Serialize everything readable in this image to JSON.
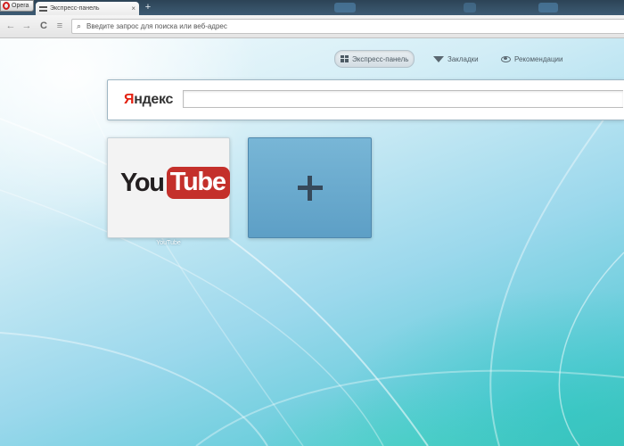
{
  "browser": {
    "menu_label": "Opera",
    "active_tab": {
      "title": "Экспресс-панель",
      "close_glyph": "×"
    },
    "new_tab_glyph": "+"
  },
  "toolbar": {
    "back_glyph": "←",
    "forward_glyph": "→",
    "reload_glyph": "C",
    "speed_dial_glyph": "≡",
    "address_placeholder": "Введите запрос для поиска или веб-адрес"
  },
  "speed_dial": {
    "menu": [
      {
        "label": "Экспресс-панель",
        "icon": "speed-dial-icon",
        "active": true
      },
      {
        "label": "Закладки",
        "icon": "bookmark-icon",
        "active": false
      },
      {
        "label": "Рекомендации",
        "icon": "eye-icon",
        "active": false
      }
    ],
    "search": {
      "engine": "Яндекс",
      "engine_first_letter": "Я",
      "engine_rest": "ндекс"
    },
    "tiles": [
      {
        "title": "YouTube",
        "logo_you": "You",
        "logo_tube": "Tube"
      },
      {
        "type": "add",
        "icon": "plus-icon"
      }
    ]
  },
  "colors": {
    "opera_red": "#d11c1c",
    "yandex_red": "#e32112",
    "youtube_red": "#c4302b",
    "add_tile": "#6aa9cd"
  }
}
